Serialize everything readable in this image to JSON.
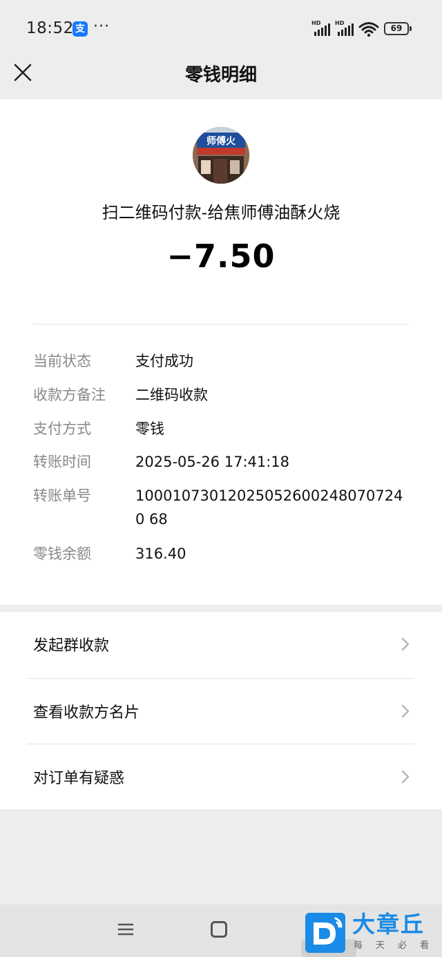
{
  "status_bar": {
    "time": "18:52",
    "app_badge": "支",
    "more": "···",
    "signal_label": "HD",
    "battery": "69"
  },
  "nav": {
    "title": "零钱明细"
  },
  "transaction": {
    "merchant_title": "扫二维码付款-给焦师傅油酥火烧",
    "amount": "−7.50",
    "details": [
      {
        "label": "当前状态",
        "value": "支付成功"
      },
      {
        "label": "收款方备注",
        "value": "二维码收款"
      },
      {
        "label": "支付方式",
        "value": "零钱"
      },
      {
        "label": "转账时间",
        "value": "2025-05-26 17:41:18"
      },
      {
        "label": "转账单号",
        "value": "100010730120250526002480707240 68"
      },
      {
        "label": "零钱余额",
        "value": "316.40"
      }
    ]
  },
  "actions": [
    {
      "label": "发起群收款"
    },
    {
      "label": "查看收款方名片"
    },
    {
      "label": "对订单有疑惑"
    }
  ],
  "watermark": {
    "brand": "大章丘",
    "tagline": "每天必看"
  },
  "colors": {
    "page_bg": "#ededed",
    "card_bg": "#ffffff",
    "label_gray": "#888888",
    "brand_blue": "#1a8be6",
    "alipay_blue": "#1677ff"
  }
}
